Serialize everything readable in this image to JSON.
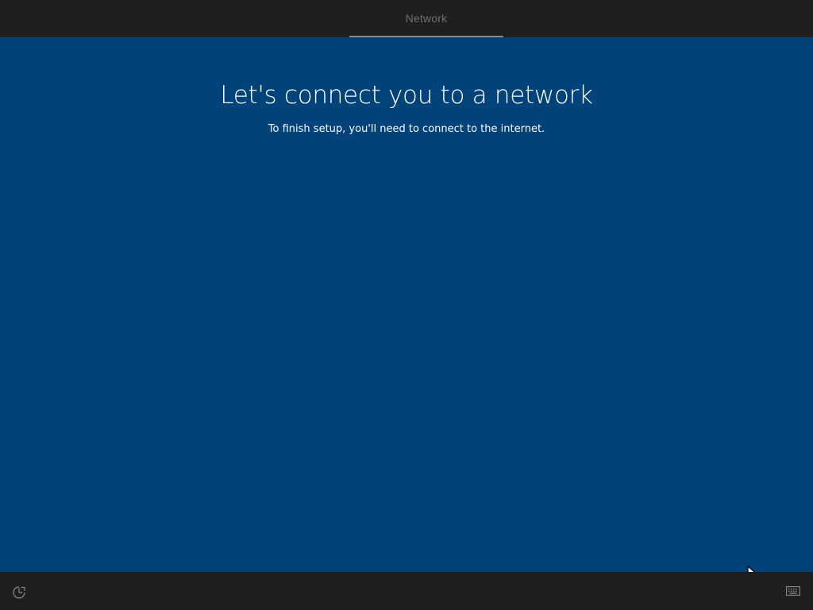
{
  "header": {
    "tabs": [
      {
        "label": "Network",
        "active": true
      }
    ]
  },
  "main": {
    "title": "Let's connect you to a network",
    "subtitle": "To finish setup, you'll need to connect to the internet."
  },
  "footer": {
    "left_icon": "ease-of-access-icon",
    "right_icon": "keyboard-icon"
  },
  "colors": {
    "background": "#00437a",
    "bars": "#1f1f1f",
    "tab_text": "#6e6e6e",
    "tab_underline": "#8a8a8a",
    "text": "#ffffff"
  }
}
